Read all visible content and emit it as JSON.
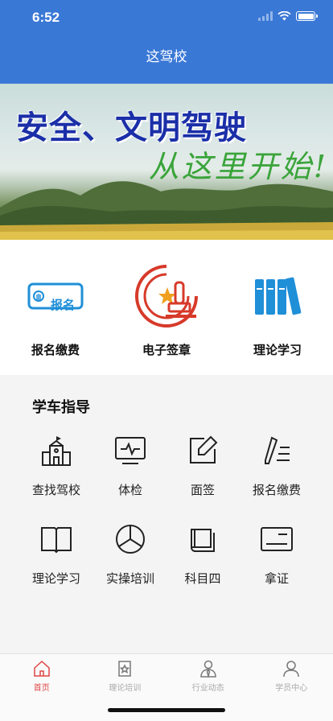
{
  "status_bar": {
    "time": "6:52"
  },
  "header": {
    "title": "这驾校"
  },
  "banner": {
    "line1": "安全、文明驾驶",
    "line2": "从这里开始!"
  },
  "features": [
    {
      "label": "报名缴费",
      "icon": "signup-badge-icon",
      "badge_text": "报名"
    },
    {
      "label": "电子签章",
      "icon": "stamp-icon"
    },
    {
      "label": "理论学习",
      "icon": "books-icon"
    }
  ],
  "guide": {
    "title": "学车指导",
    "items": [
      {
        "label": "查找驾校",
        "icon": "school-icon"
      },
      {
        "label": "体检",
        "icon": "monitor-pulse-icon"
      },
      {
        "label": "面签",
        "icon": "edit-icon"
      },
      {
        "label": "报名缴费",
        "icon": "pen-list-icon"
      },
      {
        "label": "理论学习",
        "icon": "open-book-icon"
      },
      {
        "label": "实操培训",
        "icon": "steering-wheel-icon"
      },
      {
        "label": "科目四",
        "icon": "book-stack-icon"
      },
      {
        "label": "拿证",
        "icon": "license-card-icon"
      }
    ]
  },
  "tabbar": {
    "items": [
      {
        "label": "首页",
        "icon": "home-icon",
        "active": true
      },
      {
        "label": "理论培训",
        "icon": "star-doc-icon",
        "active": false
      },
      {
        "label": "行业动态",
        "icon": "person-tie-icon",
        "active": false
      },
      {
        "label": "学员中心",
        "icon": "user-icon",
        "active": false
      }
    ]
  },
  "colors": {
    "header_bg": "#3a78d6",
    "accent_red": "#e04545",
    "feature_blue": "#1f8fd8",
    "stamp_red": "#d73a2a"
  }
}
